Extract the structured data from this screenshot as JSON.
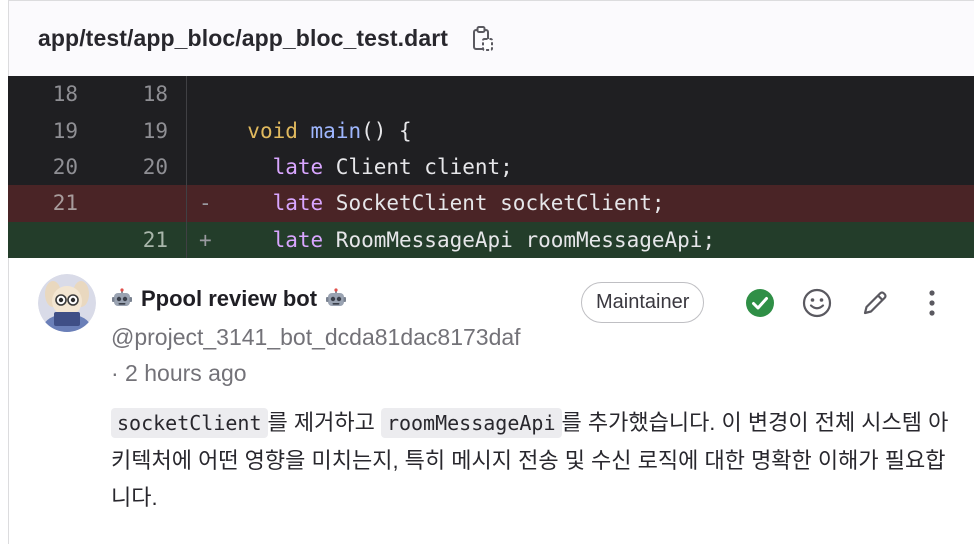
{
  "file": {
    "path": "app/test/app_bloc/app_bloc_test.dart",
    "copy_icon": "copy-clipboard-icon"
  },
  "diff": {
    "lines": [
      {
        "old": "18",
        "new": "18",
        "marker": "",
        "type": "context"
      },
      {
        "old": "19",
        "new": "19",
        "marker": "",
        "type": "context"
      },
      {
        "old": "20",
        "new": "20",
        "marker": "",
        "type": "context"
      },
      {
        "old": "21",
        "new": "",
        "marker": "-",
        "type": "removed"
      },
      {
        "old": "",
        "new": "21",
        "marker": "+",
        "type": "added"
      }
    ],
    "tokens": {
      "l19_kw": "void",
      "l19_fn": "main",
      "l19_rest": "() {",
      "l20_kw": "late",
      "l20_rest": " Client client;",
      "l21_kw": "late",
      "l21_rest": " SocketClient socketClient;",
      "l22_kw": "late",
      "l22_rest": " RoomMessageApi roomMessageApi;"
    },
    "colors": {
      "removed_bg": "#4a2426",
      "added_bg": "#233d2a",
      "code_bg": "#1f1f22"
    }
  },
  "comment": {
    "author_name": "Ppool review bot",
    "author_emoji": "robot-icon",
    "handle": "@project_3141_bot_dcda81dac8173daf",
    "time": "· 2 hours ago",
    "role_badge": "Maintainer",
    "body": {
      "code1": "socketClient",
      "text1": "를 제거하고 ",
      "code2": "roomMessageApi",
      "text2": "를 추가했습니다. 이 변경이 전체 시스템 아키텍처에 어떤 영향을 미치는지, 특히 메시지 전송 및 수신 로직에 대한 명확한 이해가 필요합니다."
    },
    "actions": [
      "resolve-check-icon",
      "emoji-reaction-icon",
      "edit-pencil-icon",
      "more-actions-icon"
    ],
    "resolve_color": "#2f8f46"
  }
}
